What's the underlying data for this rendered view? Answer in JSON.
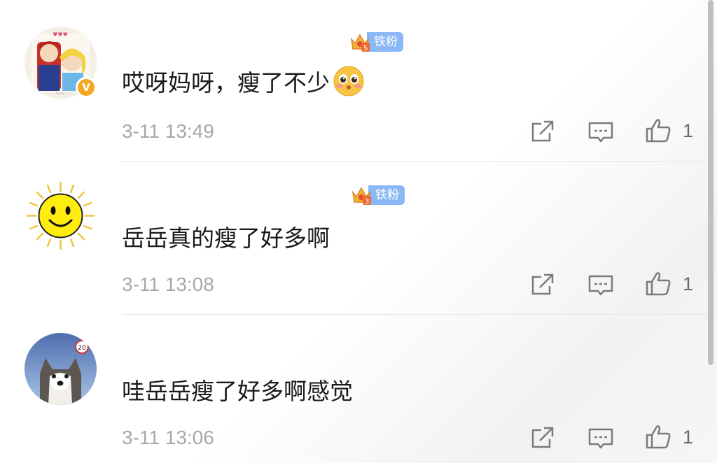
{
  "comments": [
    {
      "text": "哎呀妈呀，瘦了不少",
      "has_emoji": true,
      "emoji": "shy-face",
      "fan_level": "5",
      "fan_label": "铁粉",
      "verified": true,
      "timestamp": "3-11 13:49",
      "likes": "1"
    },
    {
      "text": "岳岳真的瘦了好多啊",
      "has_emoji": false,
      "fan_level": "3",
      "fan_label": "铁粉",
      "verified": false,
      "timestamp": "3-11 13:08",
      "likes": "1"
    },
    {
      "text": "哇岳岳瘦了好多啊感觉",
      "has_emoji": false,
      "fan_level": "",
      "fan_label": "",
      "verified": false,
      "timestamp": "3-11 13:06",
      "likes": "1"
    }
  ],
  "icons": {
    "share": "share-icon",
    "reply": "comment-icon",
    "like": "thumbs-up-icon",
    "verified": "verified-v-badge"
  },
  "colors": {
    "fan_badge": "#8ab7f5",
    "verified": "#f5a623",
    "timestamp": "#a8a8a8",
    "text": "#1a1a1a"
  }
}
